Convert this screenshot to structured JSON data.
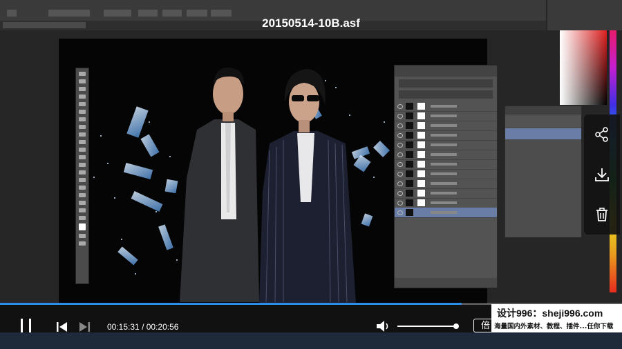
{
  "player": {
    "title": "20150514-10B.asf",
    "current_time": "00:15:31",
    "time_separator": "/",
    "duration": "00:20:56",
    "progress_fraction": 0.742,
    "volume_fraction": 1.0,
    "speed_label": "倍"
  },
  "side_actions": [
    {
      "icon": "share-icon"
    },
    {
      "icon": "download-icon"
    },
    {
      "icon": "trash-icon"
    }
  ],
  "watermark": {
    "line1": "设计996：sheji996.com",
    "line2": "海量国内外素材、教程、插件...任你下载"
  },
  "colors": {
    "progress": "#2d8ce6",
    "selected_layer": "#6a7da6"
  }
}
